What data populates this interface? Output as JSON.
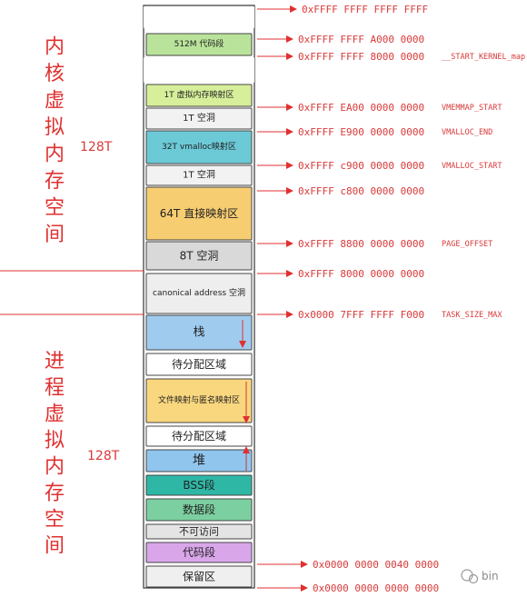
{
  "kernel_label": [
    "内",
    "核",
    "虚",
    "拟",
    "内",
    "存",
    "空",
    "间"
  ],
  "user_label": [
    "进",
    "程",
    "虚",
    "拟",
    "内",
    "存",
    "空",
    "间"
  ],
  "kernel_size": "128T",
  "user_size": "128T",
  "segments": [
    {
      "label": "",
      "color": "#ffffff"
    },
    {
      "label": "512M 代码段",
      "color": "#b9e39a"
    },
    {
      "label": "",
      "color": "#ffffff"
    },
    {
      "label": "1T 虚拟内存映射区",
      "color": "#d7ef9a"
    },
    {
      "label": "1T 空洞",
      "color": "#f2f2f2"
    },
    {
      "label": "32T vmalloc映射区",
      "color": "#6cc9d6"
    },
    {
      "label": "1T 空洞",
      "color": "#f2f2f2"
    },
    {
      "label": "64T 直接映射区",
      "color": "#f7cd72"
    },
    {
      "label": "8T 空洞",
      "color": "#d9d9d9"
    },
    {
      "label": "",
      "color": "#ffffff"
    },
    {
      "label": "canonical address 空洞",
      "color": "#eeeeee"
    },
    {
      "label": "",
      "color": "#ffffff"
    },
    {
      "label": "栈",
      "color": "#9fcbef"
    },
    {
      "label": "待分配区域",
      "color": "#ffffff"
    },
    {
      "label": "文件映射与匿名映射区",
      "color": "#f9d77e"
    },
    {
      "label": "待分配区域",
      "color": "#ffffff"
    },
    {
      "label": "堆",
      "color": "#90c6ee"
    },
    {
      "label": "BSS段",
      "color": "#2fb7a6"
    },
    {
      "label": "数据段",
      "color": "#7ccfa0"
    },
    {
      "label": "不可访问",
      "color": "#e4e4e4"
    },
    {
      "label": "代码段",
      "color": "#d9a6ea"
    },
    {
      "label": "保留区",
      "color": "#efefef"
    }
  ],
  "addresses": [
    {
      "addr": "0xFFFF FFFF FFFF FFFF",
      "symbol": ""
    },
    {
      "addr": "0xFFFF FFFF A000 0000",
      "symbol": ""
    },
    {
      "addr": "0xFFFF FFFF 8000 0000",
      "symbol": "__START_KERNEL_map"
    },
    {
      "addr": "0xFFFF EA00 0000 0000",
      "symbol": "VMEMMAP_START"
    },
    {
      "addr": "0xFFFF E900 0000 0000",
      "symbol": "VMALLOC_END"
    },
    {
      "addr": "0xFFFF c900 0000 0000",
      "symbol": "VMALLOC_START"
    },
    {
      "addr": "0xFFFF c800 0000 0000",
      "symbol": ""
    },
    {
      "addr": "0xFFFF 8800 0000 0000",
      "symbol": "PAGE_OFFSET"
    },
    {
      "addr": "0xFFFF 8000 0000 0000",
      "symbol": ""
    },
    {
      "addr": "0x0000 7FFF FFFF F000",
      "symbol": "TASK_SIZE_MAX"
    },
    {
      "addr": "0x0000 0000 0040 0000",
      "symbol": ""
    },
    {
      "addr": "0x0000 0000 0000 0000",
      "symbol": ""
    }
  ],
  "watermark": "bin"
}
